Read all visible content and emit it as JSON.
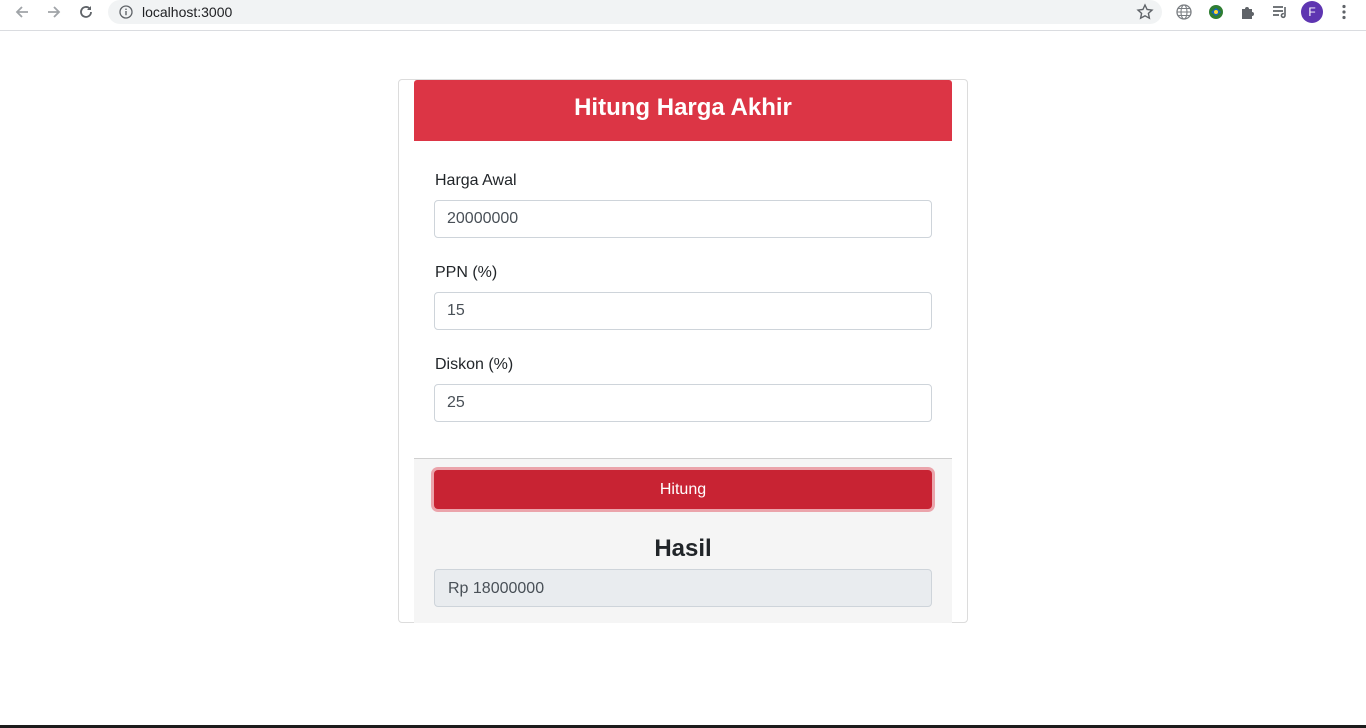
{
  "browser": {
    "url": "localhost:3000",
    "profile_initial": "F",
    "icons": [
      "back-icon",
      "forward-icon",
      "reload-icon",
      "info-icon",
      "star-icon",
      "globe-icon",
      "extension-icon",
      "puzzle-icon",
      "reading-list-icon",
      "avatar",
      "more-icon"
    ],
    "accent": "#5e35b1"
  },
  "form": {
    "title": "Hitung Harga Akhir",
    "fields": [
      {
        "label": "Harga Awal",
        "value": "20000000"
      },
      {
        "label": "PPN (%)",
        "value": "15"
      },
      {
        "label": "Diskon (%)",
        "value": "25"
      }
    ],
    "button_label": "Hitung",
    "result_title": "Hasil",
    "result_value": "Rp 18000000"
  },
  "colors": {
    "header": "#dc3545",
    "button": "#c82333",
    "result_bg": "#e9ecef"
  }
}
